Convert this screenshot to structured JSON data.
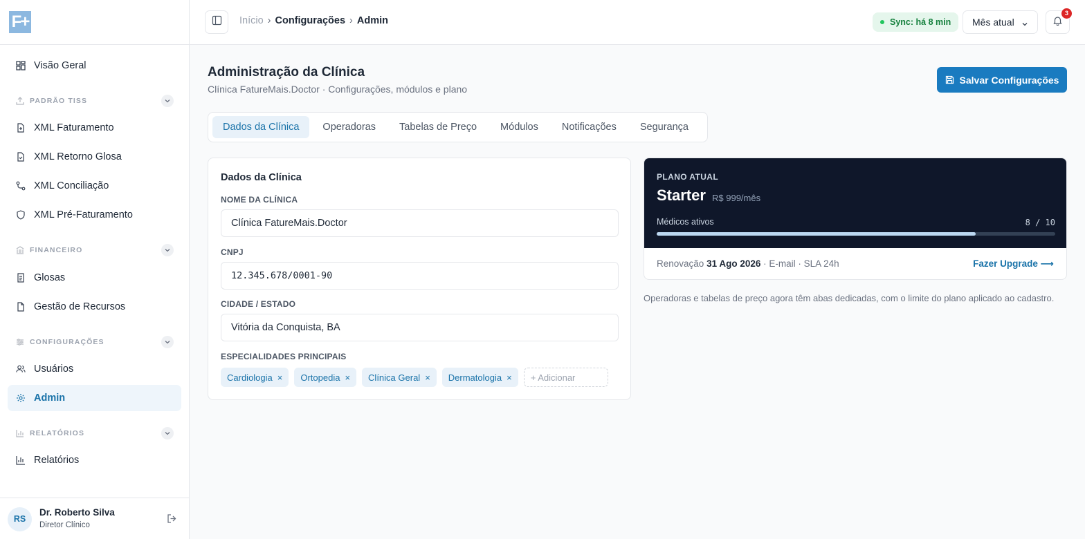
{
  "logo": {
    "text": "F+"
  },
  "sidebar": {
    "overview": "Visão Geral",
    "sections": {
      "tiss": "PADRÃO TISS",
      "financeiro": "FINANCEIRO",
      "config": "CONFIGURAÇÕES",
      "relatorios": "RELATÓRIOS"
    },
    "items": {
      "xml_faturamento": "XML Faturamento",
      "xml_retorno": "XML Retorno Glosa",
      "xml_conciliacao": "XML Conciliação",
      "xml_prefat": "XML Pré-Faturamento",
      "glosas": "Glosas",
      "recursos": "Gestão de Recursos",
      "usuarios": "Usuários",
      "admin": "Admin",
      "relatorios": "Relatórios"
    },
    "user": {
      "initials": "RS",
      "name": "Dr. Roberto Silva",
      "role": "Diretor Clínico"
    }
  },
  "topbar": {
    "breadcrumb": [
      "Início",
      "Configurações",
      "Admin"
    ],
    "breadcrumb_sep": "›",
    "sync": "Sync: há 8 min",
    "period": "Mês atual",
    "notifications": "3"
  },
  "page": {
    "title": "Administração da Clínica",
    "subtitle": "Clínica FatureMais.Doctor · Configurações, módulos e plano",
    "save_label": "Salvar Configurações"
  },
  "tabs": [
    "Dados da Clínica",
    "Operadoras",
    "Tabelas de Preço",
    "Módulos",
    "Notificações",
    "Segurança"
  ],
  "form": {
    "title": "Dados da Clínica",
    "name_label": "NOME DA CLÍNICA",
    "name_value": "Clínica FatureMais.Doctor",
    "cnpj_label": "CNPJ",
    "cnpj_value": "12.345.678/0001-90",
    "city_label": "CIDADE / ESTADO",
    "city_value": "Vitória da Conquista, BA",
    "specialties_label": "ESPECIALIDADES PRINCIPAIS",
    "specialties": [
      "Cardiologia",
      "Ortopedia",
      "Clínica Geral",
      "Dermatologia"
    ],
    "remove_glyph": "×",
    "add_placeholder": "+ Adicionar"
  },
  "plan": {
    "label": "PLANO ATUAL",
    "name": "Starter",
    "price": "R$ 999/mês",
    "usage_label": "Médicos ativos",
    "usage_text": "8 / 10",
    "usage_fraction": 0.8,
    "renewal_label": "Renovação",
    "renewal_date": "31 Ago 2026",
    "renewal_extra": "· E-mail · SLA 24h",
    "upgrade": "Fazer Upgrade ⟶"
  },
  "note": "Operadoras e tabelas de preço agora têm abas dedicadas, com o limite do plano aplicado ao cadastro.",
  "colors": {
    "accent": "#1a7bc0",
    "plan_bg": "#0f172a",
    "sync_green": "#22c55e",
    "badge_red": "#dc2626"
  }
}
